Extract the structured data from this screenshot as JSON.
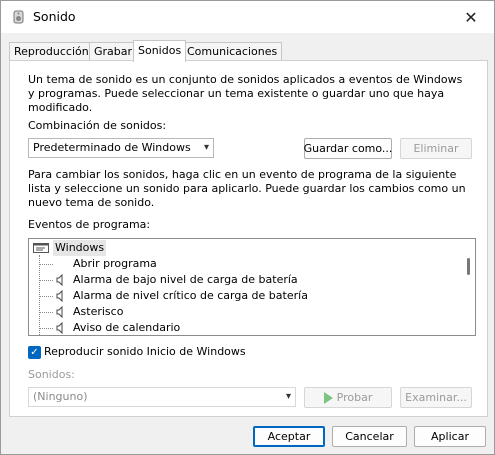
{
  "window": {
    "title": "Sonido",
    "close_glyph": "✕"
  },
  "tabs": [
    {
      "label": "Reproducción"
    },
    {
      "label": "Grabar"
    },
    {
      "label": "Sonidos"
    },
    {
      "label": "Comunicaciones"
    }
  ],
  "intro_text": "Un tema de sonido es un conjunto de sonidos aplicados a eventos de Windows y programas. Puede seleccionar un tema existente o guardar uno que haya modificado.",
  "scheme": {
    "label": "Combinación de sonidos:",
    "selected": "Predeterminado de Windows",
    "save_label": "Guardar como...",
    "delete_label": "Eliminar"
  },
  "instructions_text": "Para cambiar los sonidos, haga clic en un evento de programa de la siguiente lista y seleccione un sonido para aplicarlo. Puede guardar los cambios como un nuevo tema de sonido.",
  "events": {
    "label": "Eventos de programa:",
    "root": "Windows",
    "items": [
      {
        "label": "Abrir programa",
        "has_sound": false
      },
      {
        "label": "Alarma de bajo nivel de carga de batería",
        "has_sound": true
      },
      {
        "label": "Alarma de nivel crítico de carga de batería",
        "has_sound": true
      },
      {
        "label": "Asterisco",
        "has_sound": true
      },
      {
        "label": "Aviso de calendario",
        "has_sound": true
      }
    ]
  },
  "startup_checkbox": {
    "label": "Reproducir sonido Inicio de Windows",
    "checked": true
  },
  "sounds": {
    "label": "Sonidos:",
    "selected": "(Ninguno)",
    "test_label": "Probar",
    "browse_label": "Examinar..."
  },
  "footer": {
    "ok_label": "Aceptar",
    "cancel_label": "Cancelar",
    "apply_label": "Aplicar"
  },
  "colors": {
    "accent": "#0067c0",
    "selection": "#e6e6e6",
    "play": "#4caf50"
  }
}
